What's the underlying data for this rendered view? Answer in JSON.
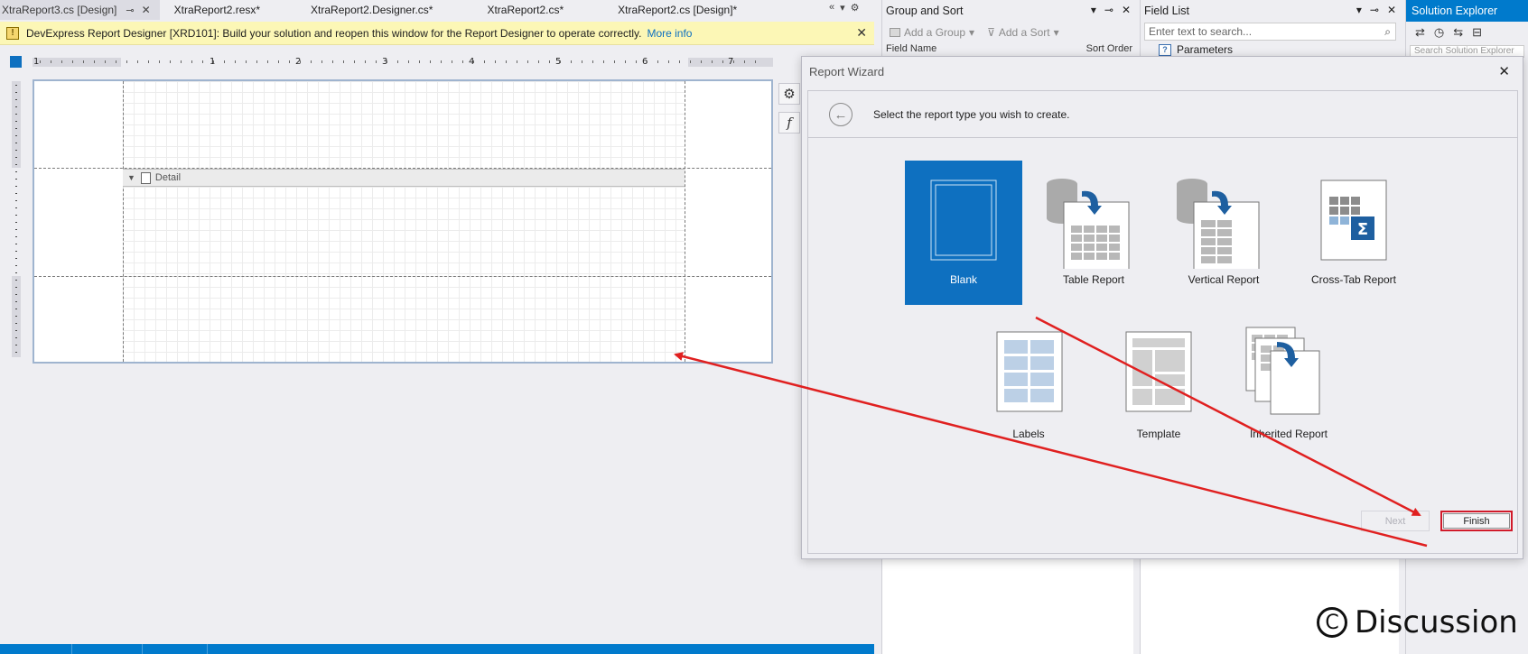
{
  "tabs": [
    {
      "label": "XtraReport3.cs [Design]",
      "active": true
    },
    {
      "label": "XtraReport2.resx*"
    },
    {
      "label": "XtraReport2.Designer.cs*"
    },
    {
      "label": "XtraReport2.cs*"
    },
    {
      "label": "XtraReport2.cs [Design]*"
    }
  ],
  "info_bar": {
    "message": "DevExpress Report Designer [XRD101]: Build your solution and reopen this window for the Report Designer to operate correctly.",
    "link": "More info"
  },
  "ruler": {
    "labels": [
      "1",
      "1",
      "2",
      "3",
      "4",
      "5",
      "6",
      "7"
    ]
  },
  "designer": {
    "detail_band": "Detail",
    "side_buttons": [
      {
        "icon": "gear-icon",
        "glyph": "⚙"
      },
      {
        "icon": "function-icon",
        "glyph": "f"
      }
    ]
  },
  "group_sort": {
    "title": "Group and Sort",
    "add_group": "Add a Group",
    "add_sort": "Add a Sort",
    "col_field": "Field Name",
    "col_sort": "Sort Order"
  },
  "field_list": {
    "title": "Field List",
    "search_placeholder": "Enter text to search...",
    "nodes": [
      "Parameters"
    ]
  },
  "solution_explorer": {
    "title": "Solution Explorer",
    "search_placeholder": "Search Solution Explorer"
  },
  "wizard": {
    "title": "Report Wizard",
    "prompt": "Select the report type you wish to create.",
    "items": [
      {
        "label": "Blank",
        "selected": true
      },
      {
        "label": "Table Report"
      },
      {
        "label": "Vertical Report"
      },
      {
        "label": "Cross-Tab Report"
      },
      {
        "label": "Labels"
      },
      {
        "label": "Template"
      },
      {
        "label": "Inherited Report"
      }
    ],
    "next": "Next",
    "finish": "Finish"
  },
  "watermark": "Discussion",
  "colors": {
    "accent": "#0e70c0",
    "annotation": "#e02020",
    "info_bar": "#fcf7b6",
    "status_bar": "#007acc"
  }
}
